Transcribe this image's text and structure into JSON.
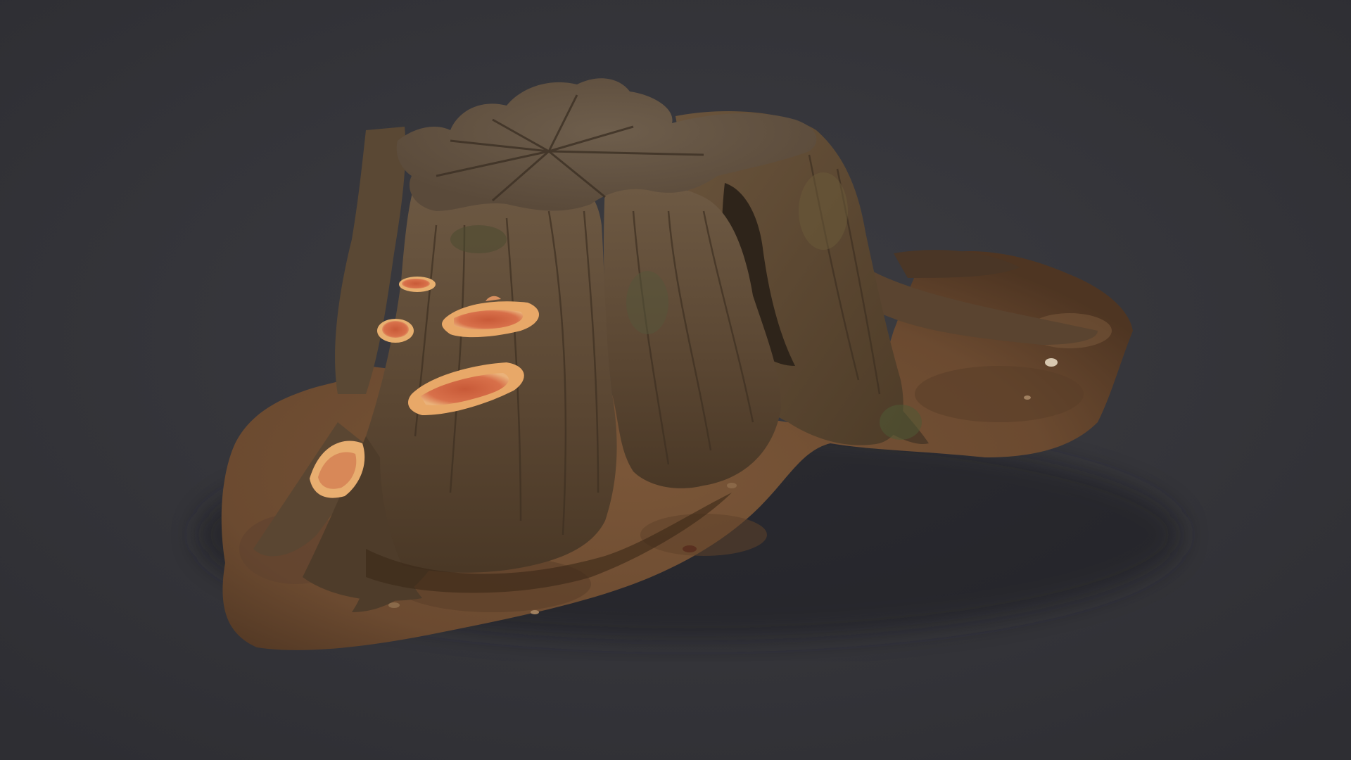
{
  "scene": {
    "subject": "",
    "background_color": "#343438",
    "background_highlight": "#3d3d42",
    "colors": {
      "soil": "#6b4a30",
      "soil_dark": "#4a3220",
      "wood_top": "#7a6650",
      "wood_side": "#5e4a36",
      "wood_dark": "#3a2c20",
      "moss": "#5a5a3a",
      "fungus": "#d8704a",
      "fungus_rim": "#e8b070",
      "shadow": "#1e1e22"
    }
  }
}
